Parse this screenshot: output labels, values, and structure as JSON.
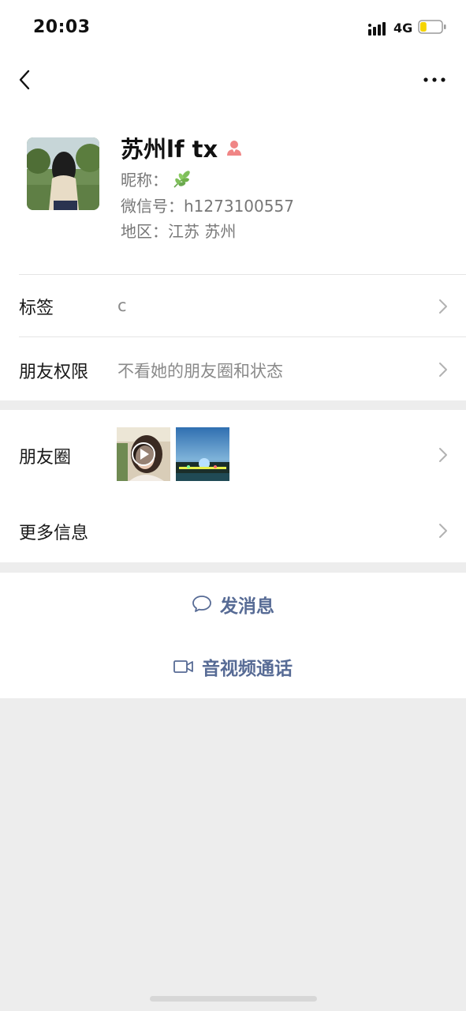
{
  "status_bar": {
    "time": "20:03",
    "network": "4G",
    "battery_level": 0.3,
    "battery_color": "#f5d400"
  },
  "nav": {
    "back_icon": "chevron-left-icon",
    "more_icon": "more-dots-icon"
  },
  "profile": {
    "name": "苏州lf tx",
    "gender_icon": "female-icon",
    "gender_color": "#f08585",
    "nickname_label": "昵称：",
    "nickname_icon": "leaf-icon",
    "wechat_id": "微信号：h1273100557",
    "region": "地区：江苏 苏州"
  },
  "rows": {
    "tags": {
      "label": "标签",
      "value": "c"
    },
    "permissions": {
      "label": "朋友权限",
      "value": "不看她的朋友圈和状态"
    },
    "moments": {
      "label": "朋友圈"
    },
    "more_info": {
      "label": "更多信息"
    }
  },
  "actions": {
    "message": {
      "label": "发消息",
      "icon": "chat-bubble-icon"
    },
    "call": {
      "label": "音视频通话",
      "icon": "video-camera-icon"
    }
  },
  "colors": {
    "link": "#576b95",
    "background": "#ededed"
  }
}
